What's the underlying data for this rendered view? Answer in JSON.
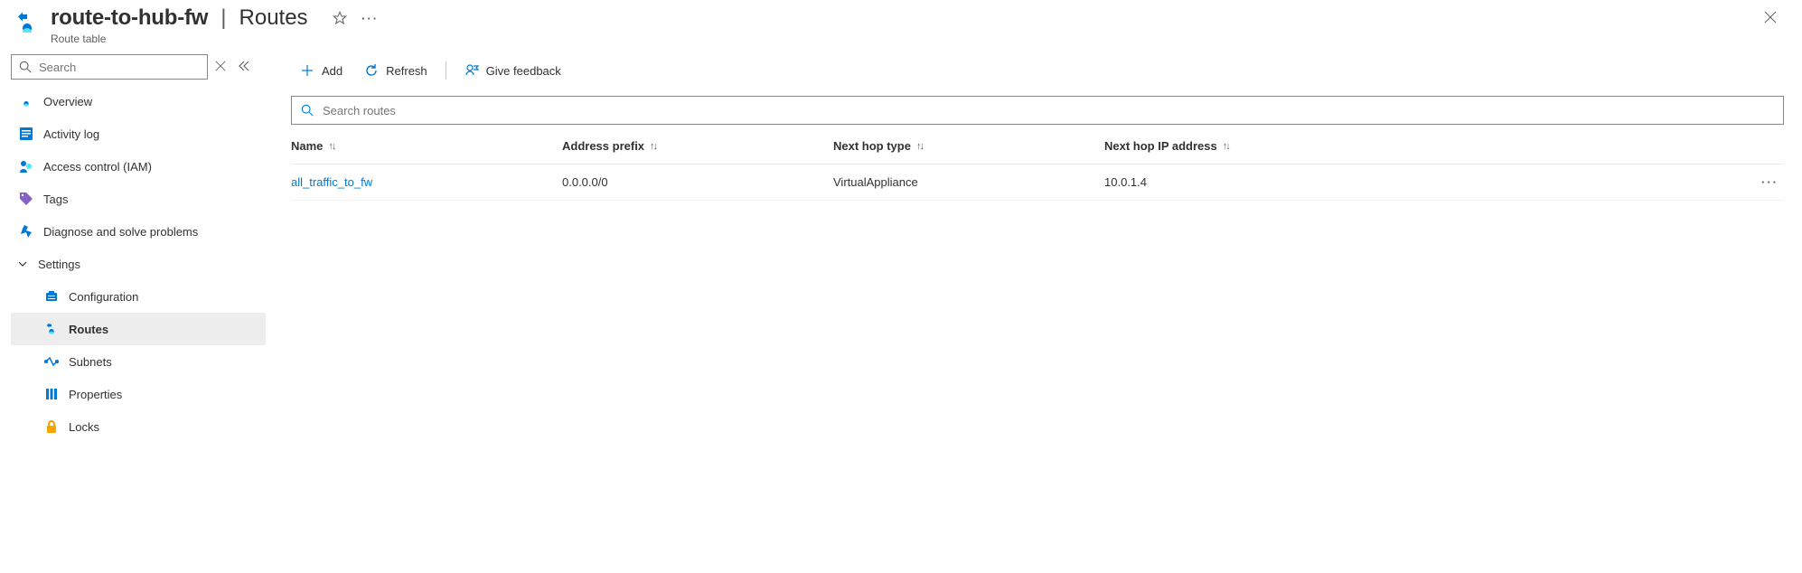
{
  "header": {
    "resource_name": "route-to-hub-fw",
    "section_name": "Routes",
    "resource_type": "Route table"
  },
  "sidebar": {
    "search_placeholder": "Search",
    "items": [
      {
        "label": "Overview"
      },
      {
        "label": "Activity log"
      },
      {
        "label": "Access control (IAM)"
      },
      {
        "label": "Tags"
      },
      {
        "label": "Diagnose and solve problems"
      }
    ],
    "settings_label": "Settings",
    "settings_items": [
      {
        "label": "Configuration"
      },
      {
        "label": "Routes"
      },
      {
        "label": "Subnets"
      },
      {
        "label": "Properties"
      },
      {
        "label": "Locks"
      }
    ]
  },
  "toolbar": {
    "add_label": "Add",
    "refresh_label": "Refresh",
    "feedback_label": "Give feedback"
  },
  "grid": {
    "search_placeholder": "Search routes",
    "columns": {
      "name": "Name",
      "address_prefix": "Address prefix",
      "next_hop_type": "Next hop type",
      "next_hop_ip": "Next hop IP address"
    },
    "rows": [
      {
        "name": "all_traffic_to_fw",
        "address_prefix": "0.0.0.0/0",
        "next_hop_type": "VirtualAppliance",
        "next_hop_ip": "10.0.1.4"
      }
    ]
  }
}
